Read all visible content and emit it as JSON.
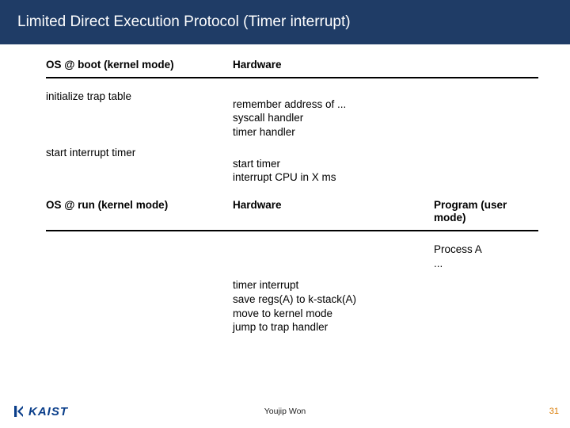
{
  "title": "Limited Direct Execution Protocol (Timer interrupt)",
  "section1": {
    "head_os": "OS @ boot\n(kernel mode)",
    "head_hw": "Hardware",
    "os_r1": "initialize trap table",
    "hw_r1": "remember address of ...\nsyscall handler\ntimer handler",
    "os_r2": "start interrupt timer",
    "hw_r2": "start timer\ninterrupt CPU in X ms"
  },
  "section2": {
    "head_os": "OS @ run\n(kernel mode)",
    "head_hw": "Hardware",
    "head_prog": "Program\n(user mode)",
    "prog_r1": "Process A\n...",
    "hw_r1": "timer interrupt\nsave regs(A) to k-stack(A)\nmove to kernel mode\njump to trap handler"
  },
  "footer": {
    "logo_text": "KAIST",
    "author": "Youjip Won",
    "page": "31"
  },
  "colors": {
    "band": "#1f3c66",
    "logo": "#0a3e8a",
    "pagenum": "#d97a00"
  }
}
